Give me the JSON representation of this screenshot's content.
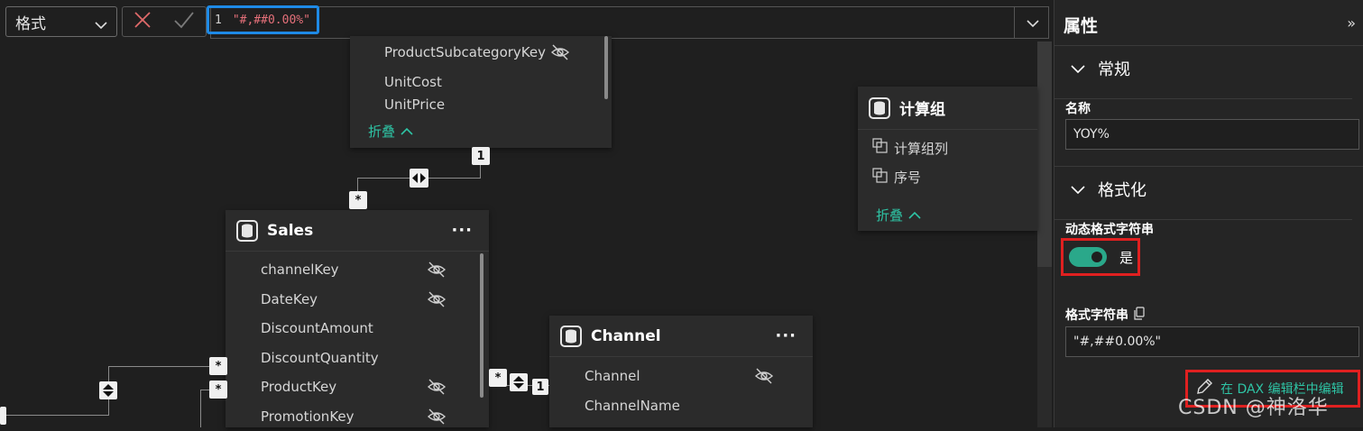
{
  "formula_bar": {
    "dropdown_label": "格式",
    "line_number": "1",
    "code": "\"#,##0.00%\""
  },
  "tables": {
    "product": {
      "fields": [
        {
          "name": "ProductSubcategoryKey",
          "hidden": true
        },
        {
          "name": "UnitCost",
          "hidden": false
        },
        {
          "name": "UnitPrice",
          "hidden": false
        }
      ],
      "collapse_label": "折叠"
    },
    "calc_group": {
      "title": "计算组",
      "fields": [
        {
          "name": "计算组列"
        },
        {
          "name": "序号"
        }
      ],
      "collapse_label": "折叠"
    },
    "sales": {
      "title": "Sales",
      "fields": [
        {
          "name": "channelKey",
          "hidden": true
        },
        {
          "name": "DateKey",
          "hidden": true
        },
        {
          "name": "DiscountAmount",
          "hidden": false
        },
        {
          "name": "DiscountQuantity",
          "hidden": false
        },
        {
          "name": "ProductKey",
          "hidden": true
        },
        {
          "name": "PromotionKey",
          "hidden": true
        }
      ]
    },
    "channel": {
      "title": "Channel",
      "fields": [
        {
          "name": "Channel",
          "hidden": true
        },
        {
          "name": "ChannelName",
          "hidden": false
        }
      ]
    }
  },
  "relationships": {
    "one": "1",
    "many": "*"
  },
  "properties_panel": {
    "title": "属性",
    "general_section": "常规",
    "name_label": "名称",
    "name_value": "YOY%",
    "format_section": "格式化",
    "dynamic_format_label": "动态格式字符串",
    "toggle_label": "是",
    "toggle_on": true,
    "format_string_label": "格式字符串",
    "format_string_value": "\"#,##0.00%\"",
    "dax_edit_label": "在 DAX 编辑栏中编辑"
  },
  "watermark": "CSDN @神洛华",
  "colors": {
    "accent_teal": "#2ec4a5",
    "toggle_on": "#2aa88a",
    "highlight_red": "#e02020",
    "highlight_blue": "#1e8ae6",
    "string_red": "#e5707a"
  }
}
